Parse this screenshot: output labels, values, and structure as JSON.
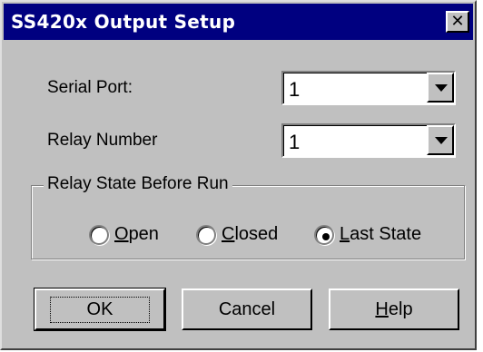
{
  "dialog": {
    "title": "SS420x Output Setup",
    "close_glyph": "✕"
  },
  "fields": {
    "serial_port_label": "Serial Port:",
    "serial_port_value": "1",
    "relay_number_label": "Relay Number",
    "relay_number_value": "1"
  },
  "group": {
    "title": "Relay State Before Run",
    "options": [
      {
        "mnemonic": "O",
        "rest": "pen",
        "label": "Open",
        "selected": false
      },
      {
        "mnemonic": "C",
        "rest": "losed",
        "label": "Closed",
        "selected": false
      },
      {
        "mnemonic": "L",
        "rest": "ast State",
        "label": "Last State",
        "selected": true
      }
    ]
  },
  "buttons": {
    "ok": "OK",
    "cancel": "Cancel",
    "help_mnemonic": "H",
    "help_rest": "elp",
    "help": "Help"
  },
  "colors": {
    "titlebar": "#000080",
    "face": "#c0c0c0"
  }
}
